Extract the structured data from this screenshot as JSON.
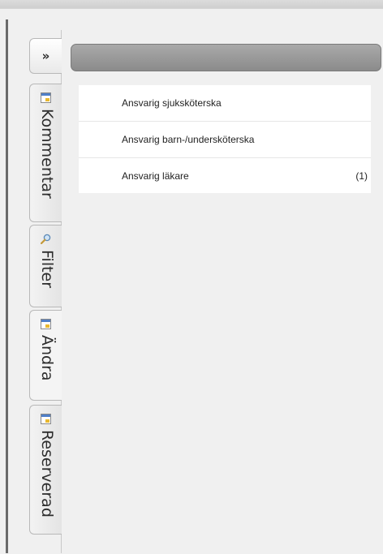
{
  "sidebar": {
    "expand_label": "»",
    "tabs": [
      {
        "label": "Kommentar",
        "icon": "window-icon"
      },
      {
        "label": "Filter",
        "icon": "magnifier-icon"
      },
      {
        "label": "Ändra",
        "icon": "window-icon"
      },
      {
        "label": "Reserverad",
        "icon": "window-icon"
      }
    ]
  },
  "panel": {
    "header_title": "",
    "items": [
      {
        "label": "Ansvarig sjuksköterska",
        "count": ""
      },
      {
        "label": "Ansvarig barn-/undersköterska",
        "count": ""
      },
      {
        "label": "Ansvarig läkare",
        "count": "(1)"
      }
    ]
  },
  "colors": {
    "header": "#999999",
    "background": "#f0f0f0",
    "left_border": "#6a6a6a"
  }
}
